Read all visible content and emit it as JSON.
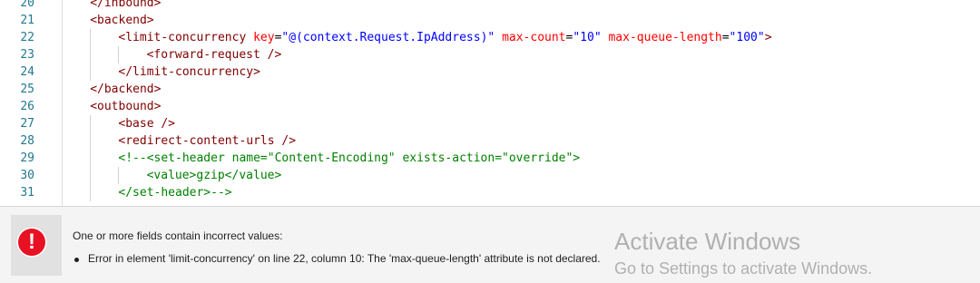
{
  "editor": {
    "lines": [
      {
        "no": "20",
        "parts": [
          {
            "c": "t",
            "s": "</inbound>"
          }
        ]
      },
      {
        "no": "21",
        "parts": [
          {
            "c": "t",
            "s": "<backend>"
          }
        ]
      },
      {
        "no": "22",
        "parts": [
          {
            "c": "t",
            "s": "<limit-concurrency "
          },
          {
            "c": "a",
            "s": "key"
          },
          {
            "c": "x",
            "s": "="
          },
          {
            "c": "v",
            "s": "\"@(context.Request.IpAddress)\""
          },
          {
            "c": "x",
            "s": " "
          },
          {
            "c": "a",
            "s": "max-count"
          },
          {
            "c": "x",
            "s": "="
          },
          {
            "c": "v",
            "s": "\"10\""
          },
          {
            "c": "x",
            "s": " "
          },
          {
            "c": "a",
            "s": "max-queue-length"
          },
          {
            "c": "x",
            "s": "="
          },
          {
            "c": "v",
            "s": "\"100\""
          },
          {
            "c": "t",
            "s": ">"
          }
        ]
      },
      {
        "no": "23",
        "parts": [
          {
            "c": "t",
            "s": "<forward-request />"
          }
        ]
      },
      {
        "no": "24",
        "parts": [
          {
            "c": "t",
            "s": "</limit-concurrency>"
          }
        ]
      },
      {
        "no": "25",
        "parts": [
          {
            "c": "t",
            "s": "</backend>"
          }
        ]
      },
      {
        "no": "26",
        "parts": [
          {
            "c": "t",
            "s": "<outbound>"
          }
        ]
      },
      {
        "no": "27",
        "parts": [
          {
            "c": "t",
            "s": "<base />"
          }
        ]
      },
      {
        "no": "28",
        "parts": [
          {
            "c": "t",
            "s": "<redirect-content-urls />"
          }
        ]
      },
      {
        "no": "29",
        "parts": [
          {
            "c": "c",
            "s": "<!--<set-header name=\"Content-Encoding\" exists-action=\"override\">"
          }
        ]
      },
      {
        "no": "30",
        "parts": [
          {
            "c": "c",
            "s": "<value>gzip</value>"
          }
        ]
      },
      {
        "no": "31",
        "parts": [
          {
            "c": "c",
            "s": "</set-header>-->"
          }
        ]
      }
    ]
  },
  "error_panel": {
    "icon": "error-icon",
    "icon_glyph": "!",
    "title": "One or more fields contain incorrect values:",
    "errors": [
      "Error in element 'limit-concurrency' on line 22, column 10: The 'max-queue-length' attribute is not declared."
    ]
  },
  "watermark": {
    "line1": "Activate Windows",
    "line2": "Go to Settings to activate Windows."
  },
  "colors": {
    "tag": "#800000",
    "attribute": "#ff0000",
    "value": "#0000ff",
    "comment": "#008000",
    "line_number": "#237893",
    "error": "#e81123"
  }
}
